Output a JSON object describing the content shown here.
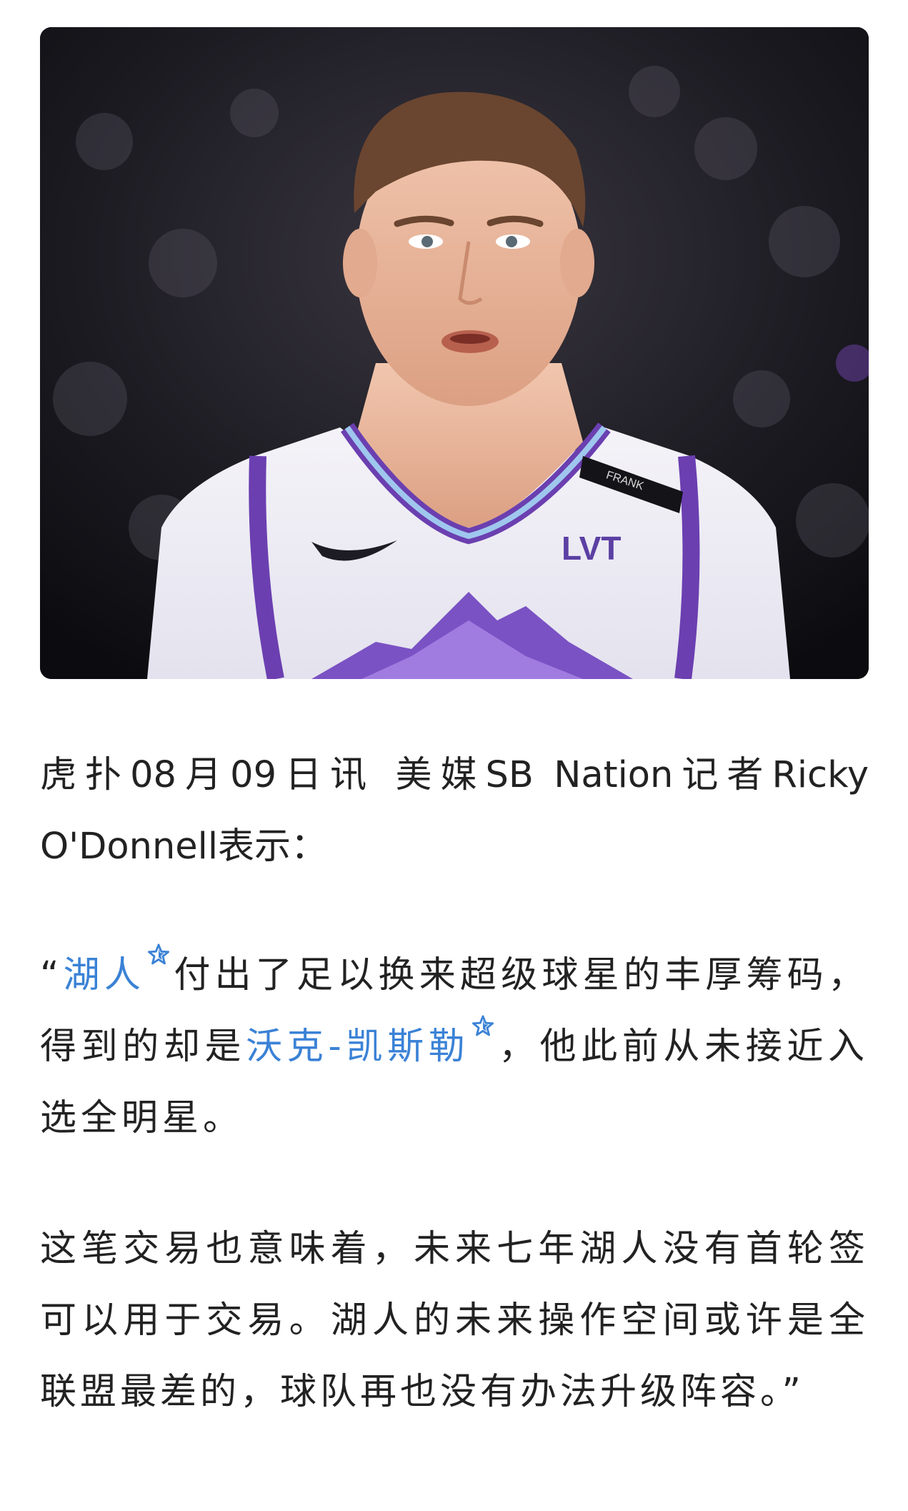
{
  "hero_image": {
    "jersey_text": "LVT",
    "armband_text": "FRANK"
  },
  "paragraph1": {
    "text": "虎扑08月09日讯 美媒SB Nation记者Ricky O'Donnell表示："
  },
  "paragraph2": {
    "open_quote": "“",
    "link1": "湖人",
    "text1": "付出了足以换来超级球星的丰厚筹码，得到的却是",
    "link2": "沃克-凯斯勒",
    "text2": "，他此前从未接近入选全明星。"
  },
  "paragraph3": {
    "text": "这笔交易也意味着，未来七年湖人没有首轮签可以用于交易。湖人的未来操作空间或许是全联盟最差的，球队再也没有办法升级阵容。”"
  },
  "colors": {
    "link": "#3b82d6",
    "text": "#222222",
    "background": "#ffffff"
  },
  "icons": {
    "link_marker": "star-icon"
  }
}
